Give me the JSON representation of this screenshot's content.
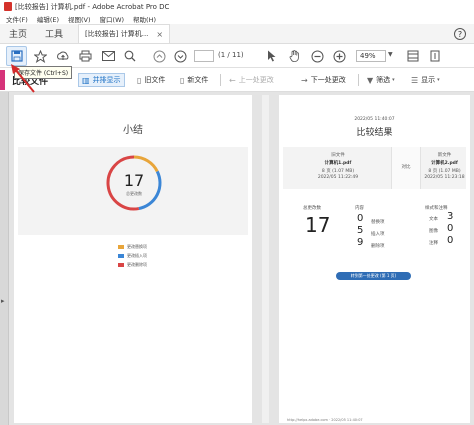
{
  "window": {
    "title": "[比较报告] 计算机.pdf - Adobe Acrobat Pro DC"
  },
  "menu": [
    "文件(F)",
    "编辑(E)",
    "视图(V)",
    "窗口(W)",
    "帮助(H)"
  ],
  "tabs": {
    "home": "主页",
    "tools": "工具",
    "document": "[比较报告] 计算机...",
    "close": "×",
    "help": "?"
  },
  "toolbar": {
    "page_current": "",
    "page_total": "(1 / 11)",
    "zoom": "49%",
    "save_tooltip": "保存文件 (Ctrl+S)"
  },
  "compare": {
    "title": "比较文件",
    "side_by_side": "并排显示",
    "old_file": "旧文件",
    "new_file": "新文件",
    "prev_change": "上一处更改",
    "next_change": "下一处更改",
    "filter": "筛选",
    "show": "显示"
  },
  "summary": {
    "title": "小结",
    "total": "17",
    "total_label": "总更改数",
    "legend": [
      {
        "label": "更改替换项",
        "color": "#e8a53a"
      },
      {
        "label": "更改插入项",
        "color": "#3b86d6"
      },
      {
        "label": "更改删除项",
        "color": "#d94545"
      }
    ],
    "donut_segments": [
      {
        "value": 3,
        "color": "#e8a53a"
      },
      {
        "value": 5,
        "color": "#3b86d6"
      },
      {
        "value": 9,
        "color": "#d94545"
      }
    ]
  },
  "result": {
    "date": "2022/05 11:40:07",
    "title": "比较结果",
    "old_label": "旧文件",
    "old_name": "计算机1.pdf",
    "old_meta1": "8 页 (1.07 MB)",
    "old_meta2": "2022/05 11:22:49",
    "vs": "对比",
    "new_label": "新文件",
    "new_name": "计算机2.pdf",
    "new_meta1": "8 页 (1.07 MB)",
    "new_meta2": "2022/05 11:23:18",
    "total": "17",
    "total_label": "总更改数",
    "content_label": "内容",
    "content_counts": [
      "0",
      "5",
      "9"
    ],
    "content_types": [
      "替换项",
      "插入项",
      "删除项"
    ],
    "format_label": "样式和注释",
    "format_counts": [
      "3",
      "0",
      "0"
    ],
    "format_types": [
      "文本",
      "图像",
      "注释"
    ],
    "button": "转到第一处更改 (第 1 页)",
    "footer": "http://helpx.adobe.com · 2022/05 11:40:07"
  }
}
